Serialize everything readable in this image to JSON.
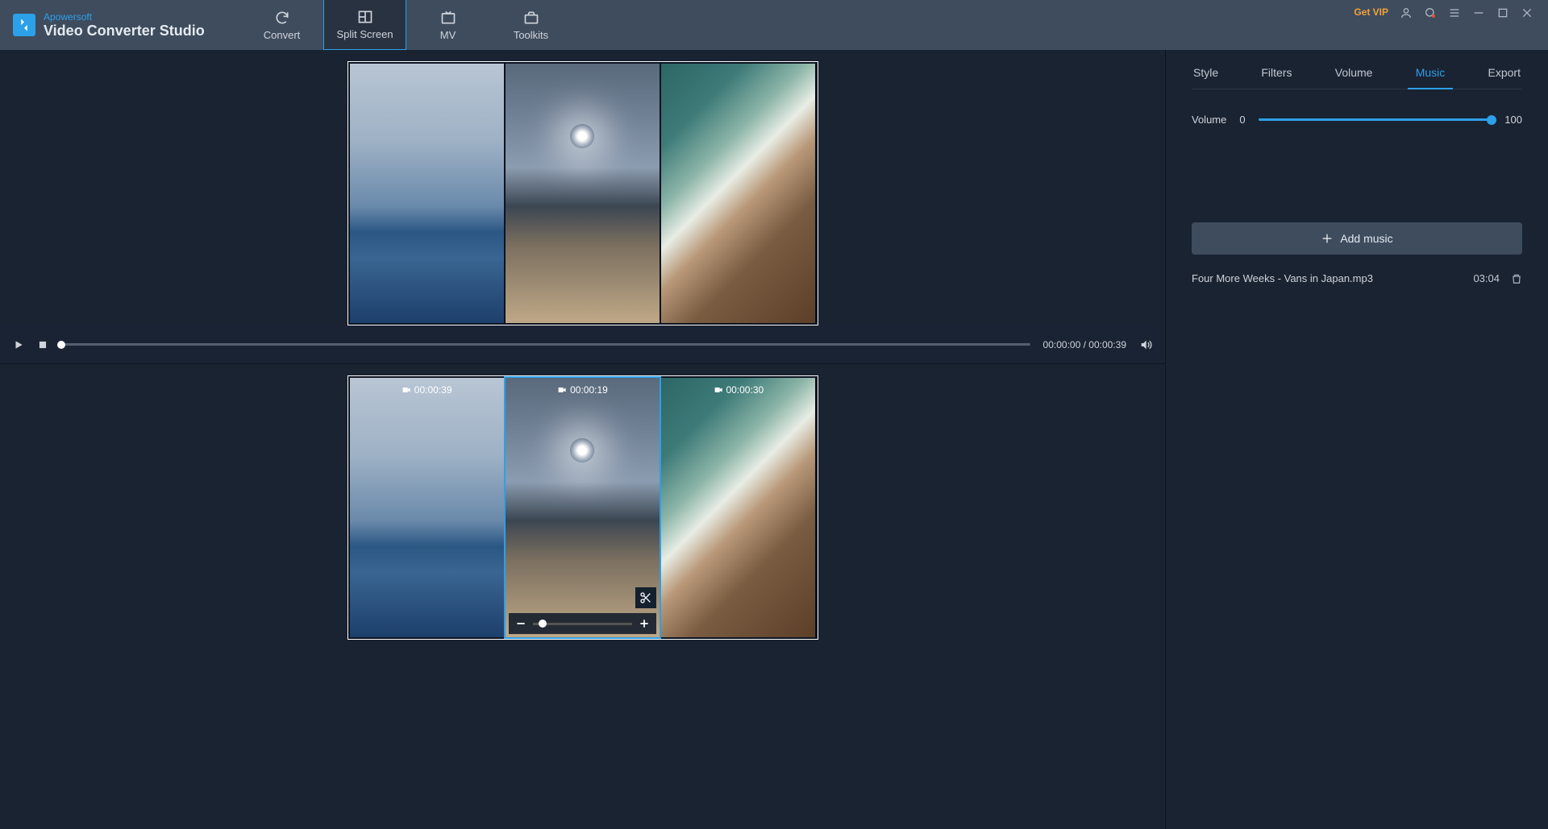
{
  "brand": "Apowersoft",
  "app_title": "Video Converter Studio",
  "nav": {
    "convert": "Convert",
    "split_screen": "Split Screen",
    "mv": "MV",
    "toolkits": "Toolkits",
    "active": "split_screen"
  },
  "window": {
    "get_vip": "Get VIP"
  },
  "playback": {
    "current": "00:00:00",
    "total": "00:00:39"
  },
  "timeline": {
    "clips": [
      {
        "duration": "00:00:39",
        "selected": false
      },
      {
        "duration": "00:00:19",
        "selected": true
      },
      {
        "duration": "00:00:30",
        "selected": false
      }
    ]
  },
  "sidebar": {
    "tabs": {
      "style": "Style",
      "filters": "Filters",
      "volume": "Volume",
      "music": "Music",
      "export": "Export",
      "active": "music"
    },
    "volume_label": "Volume",
    "volume_min": "0",
    "volume_max": "100",
    "volume_value": 100,
    "add_music": "Add music",
    "music_list": [
      {
        "title": "Four More Weeks - Vans in Japan.mp3",
        "duration": "03:04"
      }
    ]
  }
}
